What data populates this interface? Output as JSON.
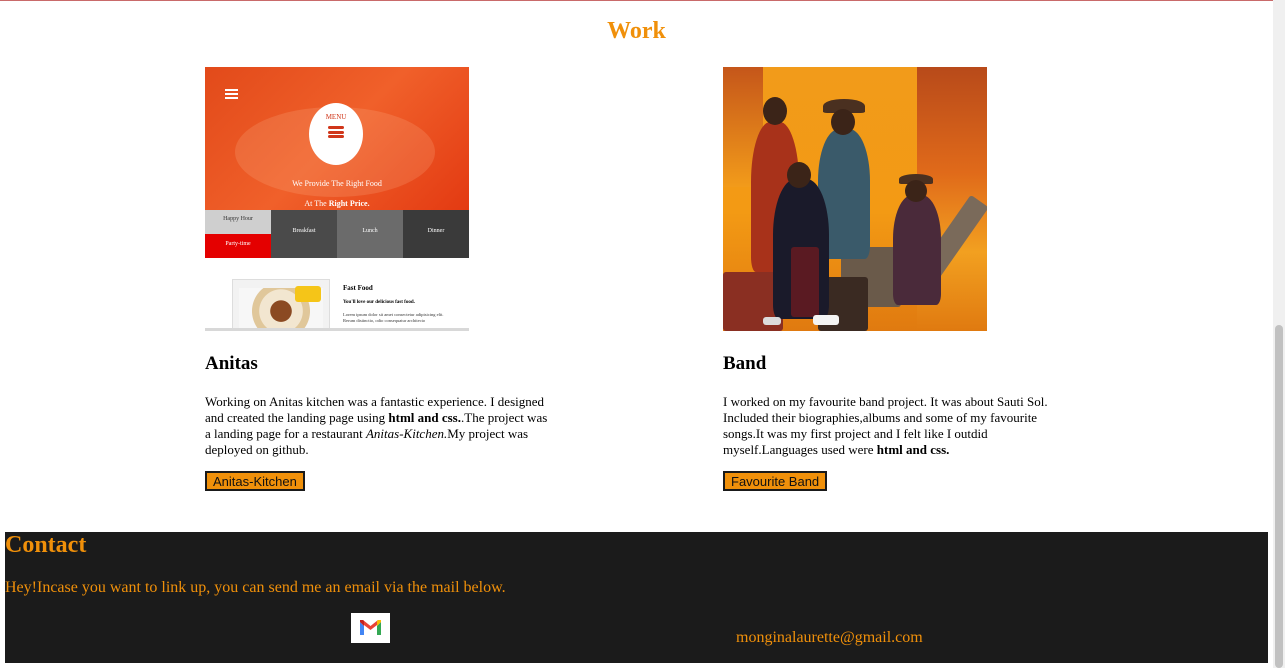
{
  "work": {
    "title": "Work",
    "projects": [
      {
        "name": "Anitas",
        "description_parts": [
          "Working on Anitas kitchen was a fantastic experience. I designed and created the landing page using ",
          "html and css.",
          ".The project was a landing page for a restaurant ",
          "Anitas-Kitchen.",
          "My project was deployed on github."
        ],
        "button": "Anitas-Kitchen",
        "preview": {
          "menu_label": "MENU",
          "tagline1": "We Provide The Right Food",
          "tagline2_prefix": "At The ",
          "tagline2_bold": "Right Price.",
          "tiles": [
            "Happy Hour",
            "Party-time",
            "Breakfast",
            "Lunch",
            "Dinner"
          ],
          "card_title": "Fast Food",
          "card_sub": "You'll love our delicious fast food.",
          "card_text": "Lorem ipsum dolor sit amet consectetur adipisicing elit. Rerum distinctio, odio consequatur architecto"
        }
      },
      {
        "name": "Band",
        "description_parts": [
          "I worked on my favourite band project. It was about Sauti Sol. Included their biographies,albums and some of my favourite songs.It was my first project and I felt like I outdid myself.Languages used were ",
          "html and css."
        ],
        "button": "Favourite Band"
      }
    ]
  },
  "contact": {
    "title": "Contact",
    "message": "Hey!Incase you want to link up, you can send me an email via the mail below.",
    "email": "monginalaurette@gmail.com",
    "mail_icon": "gmail-icon"
  },
  "colors": {
    "accent": "#f0900a",
    "footer_bg": "#1b1b1b"
  }
}
